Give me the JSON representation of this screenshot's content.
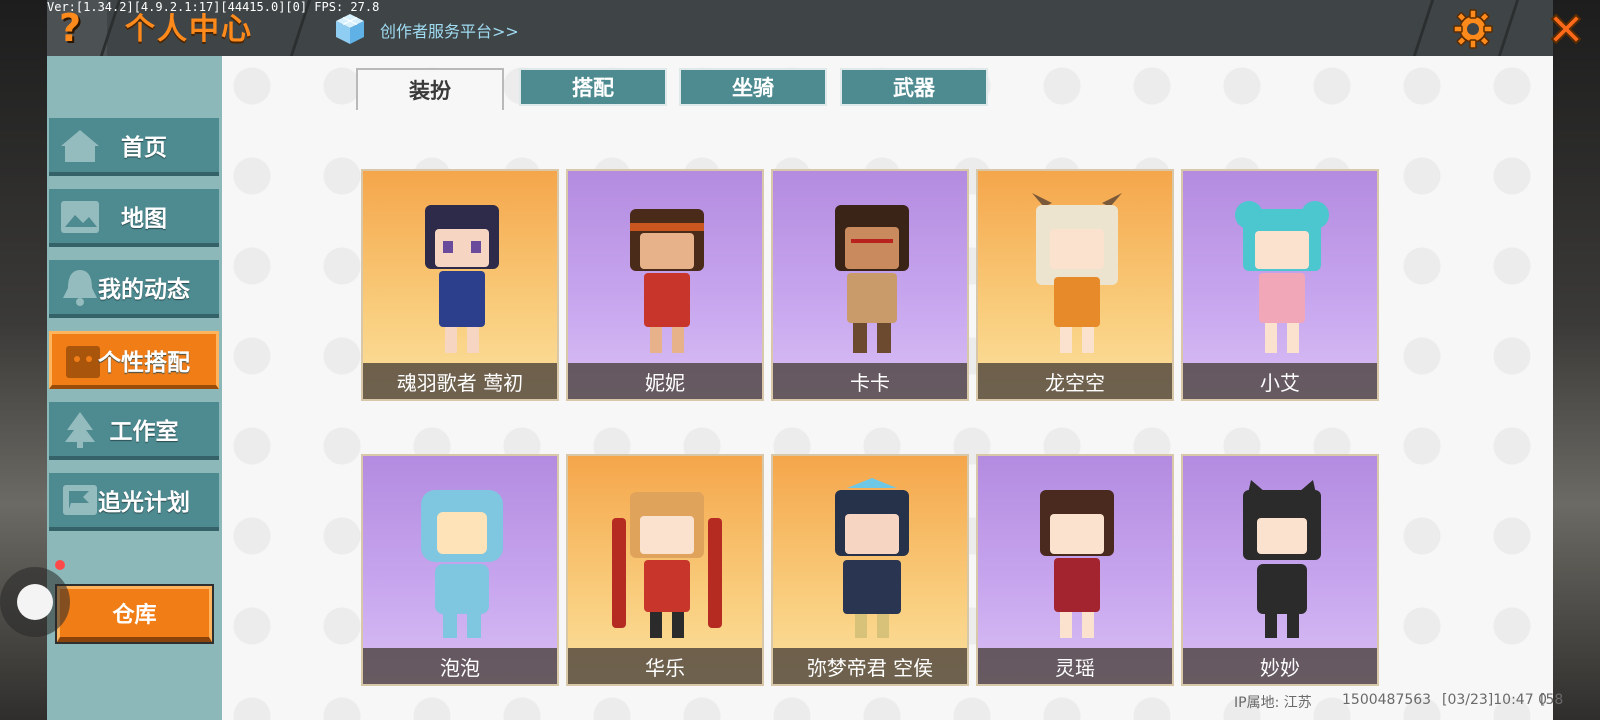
{
  "debug": "Ver:[1.34.2][4.9.2.1:17][44415.0][0] FPS: 27.8",
  "header": {
    "help_symbol": "?",
    "title": "个人中心",
    "creator_link": "创作者服务平台>>",
    "accent_color": "#ff8a1c"
  },
  "sidebar": {
    "items": [
      {
        "label": "首页",
        "icon": "home-icon"
      },
      {
        "label": "地图",
        "icon": "map-icon"
      },
      {
        "label": "我的动态",
        "icon": "bell-icon"
      },
      {
        "label": "个性搭配",
        "icon": "wardrobe-icon",
        "active": true
      },
      {
        "label": "工作室",
        "icon": "tree-icon"
      },
      {
        "label": "追光计划",
        "icon": "flag-icon"
      }
    ],
    "warehouse_label": "仓库"
  },
  "tabs": [
    {
      "label": "装扮",
      "active": true
    },
    {
      "label": "搭配"
    },
    {
      "label": "坐骑"
    },
    {
      "label": "武器"
    }
  ],
  "characters": [
    {
      "name": "魂羽歌者 莺初",
      "bg": "orange"
    },
    {
      "name": "妮妮",
      "bg": "purple"
    },
    {
      "name": "卡卡",
      "bg": "purple"
    },
    {
      "name": "龙空空",
      "bg": "orange"
    },
    {
      "name": "小艾",
      "bg": "purple"
    },
    {
      "name": "泡泡",
      "bg": "purple"
    },
    {
      "name": "华乐",
      "bg": "orange"
    },
    {
      "name": "弥梦帝君 空侯",
      "bg": "orange"
    },
    {
      "name": "灵瑶",
      "bg": "purple"
    },
    {
      "name": "妙妙",
      "bg": "purple"
    }
  ],
  "footer": {
    "ip_location": "IP属地: 江苏",
    "uid": "1500487563",
    "time": "[03/23]10:47 0",
    "extra": "[58"
  }
}
